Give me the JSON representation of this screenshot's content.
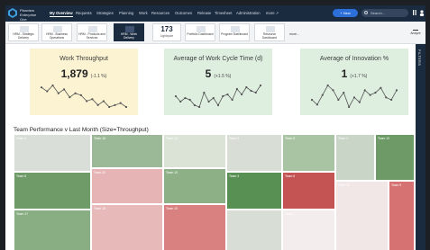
{
  "app": {
    "brand_line1": "Planview",
    "brand_line2": "Enterprise One"
  },
  "nav": [
    {
      "label": "My Overview",
      "active": true
    },
    {
      "label": "Requests",
      "active": false
    },
    {
      "label": "Strategies",
      "active": false
    },
    {
      "label": "Planning",
      "active": false
    },
    {
      "label": "Work",
      "active": false
    },
    {
      "label": "Resources",
      "active": false
    },
    {
      "label": "Outcomes",
      "active": false
    },
    {
      "label": "Release",
      "active": false
    },
    {
      "label": "Timesheet",
      "active": false
    },
    {
      "label": "Administration",
      "active": false
    },
    {
      "label": "more ↗",
      "active": false
    }
  ],
  "actions": {
    "new_label": "+ New",
    "search_placeholder": "Search..."
  },
  "tabs": [
    {
      "label": "HRM - Strategic Delivery",
      "active": false
    },
    {
      "label": "HRM - Business Operations",
      "active": false
    },
    {
      "label": "HRM - Products and Services",
      "active": false
    },
    {
      "label": "HRM - Work Delivery",
      "active": true
    }
  ],
  "kpi_tab": {
    "value": "173",
    "label": "Lightcycle"
  },
  "dashboard_tabs": [
    {
      "label": "Portfolio Dashboard"
    },
    {
      "label": "Program Dashboard"
    },
    {
      "label": "Resource Dashboard"
    }
  ],
  "more_tabs_label": "more...",
  "analyze_label": "Analyze",
  "filters_label": "FILTERS",
  "kpis": [
    {
      "title": "Work Throughput",
      "value": "1,879",
      "change": "(-1.1 %)",
      "bg": "#fbf3d2",
      "trend": [
        12,
        10,
        13,
        9,
        11,
        7,
        9,
        8,
        5,
        6,
        3,
        5,
        2,
        3,
        4,
        2
      ]
    },
    {
      "title": "Average of Work Cycle Time (d)",
      "value": "5",
      "change": "(+1.5 %)",
      "bg": "#deefe0",
      "trend": [
        8,
        5,
        7,
        6,
        3,
        2,
        10,
        5,
        7,
        3,
        8,
        9,
        6,
        12,
        9,
        13,
        11,
        10,
        14
      ]
    },
    {
      "title": "Average of Innovation %",
      "value": "1",
      "change": "(+1.7 %)",
      "bg": "#deefe0",
      "trend": [
        6,
        4,
        8,
        12,
        10,
        6,
        9,
        3,
        7,
        5,
        10,
        8,
        9,
        11,
        7,
        6,
        10
      ]
    }
  ],
  "section_title": "Team Performance v Last Month (Size=Throughput)",
  "teams": [
    {
      "label": "Team 4",
      "color": "#d9dfd8"
    },
    {
      "label": "Team 18",
      "color": "#9bb996"
    },
    {
      "label": "Team 14",
      "color": "#dbe3d6"
    },
    {
      "label": "Team 9",
      "color": "#d8ddd6"
    },
    {
      "label": "Team 5",
      "color": "#a9c4a3"
    },
    {
      "label": "Team 2",
      "color": "#c9d5c6"
    },
    {
      "label": "Team 13",
      "color": "#6e9a68"
    },
    {
      "label": "Team 8",
      "color": "#6f9b69"
    },
    {
      "label": "Team 20",
      "color": "#e6b4b4"
    },
    {
      "label": "Team 19",
      "color": "#8db087"
    },
    {
      "label": "Team 3",
      "color": "#588f52"
    },
    {
      "label": "Team 6",
      "color": "#c45454"
    },
    {
      "label": "Team 17",
      "color": "#8aae83"
    },
    {
      "label": "Team 15",
      "color": "#e7b9b9"
    },
    {
      "label": "Team 10",
      "color": "#d98181"
    },
    {
      "label": "Team 7",
      "color": "#f4eded"
    },
    {
      "label": "Team 11",
      "color": "#f1e7e7"
    },
    {
      "label": "Team 9",
      "color": "#d67272"
    },
    {
      "label": "",
      "color": "#d8ddd6"
    }
  ]
}
